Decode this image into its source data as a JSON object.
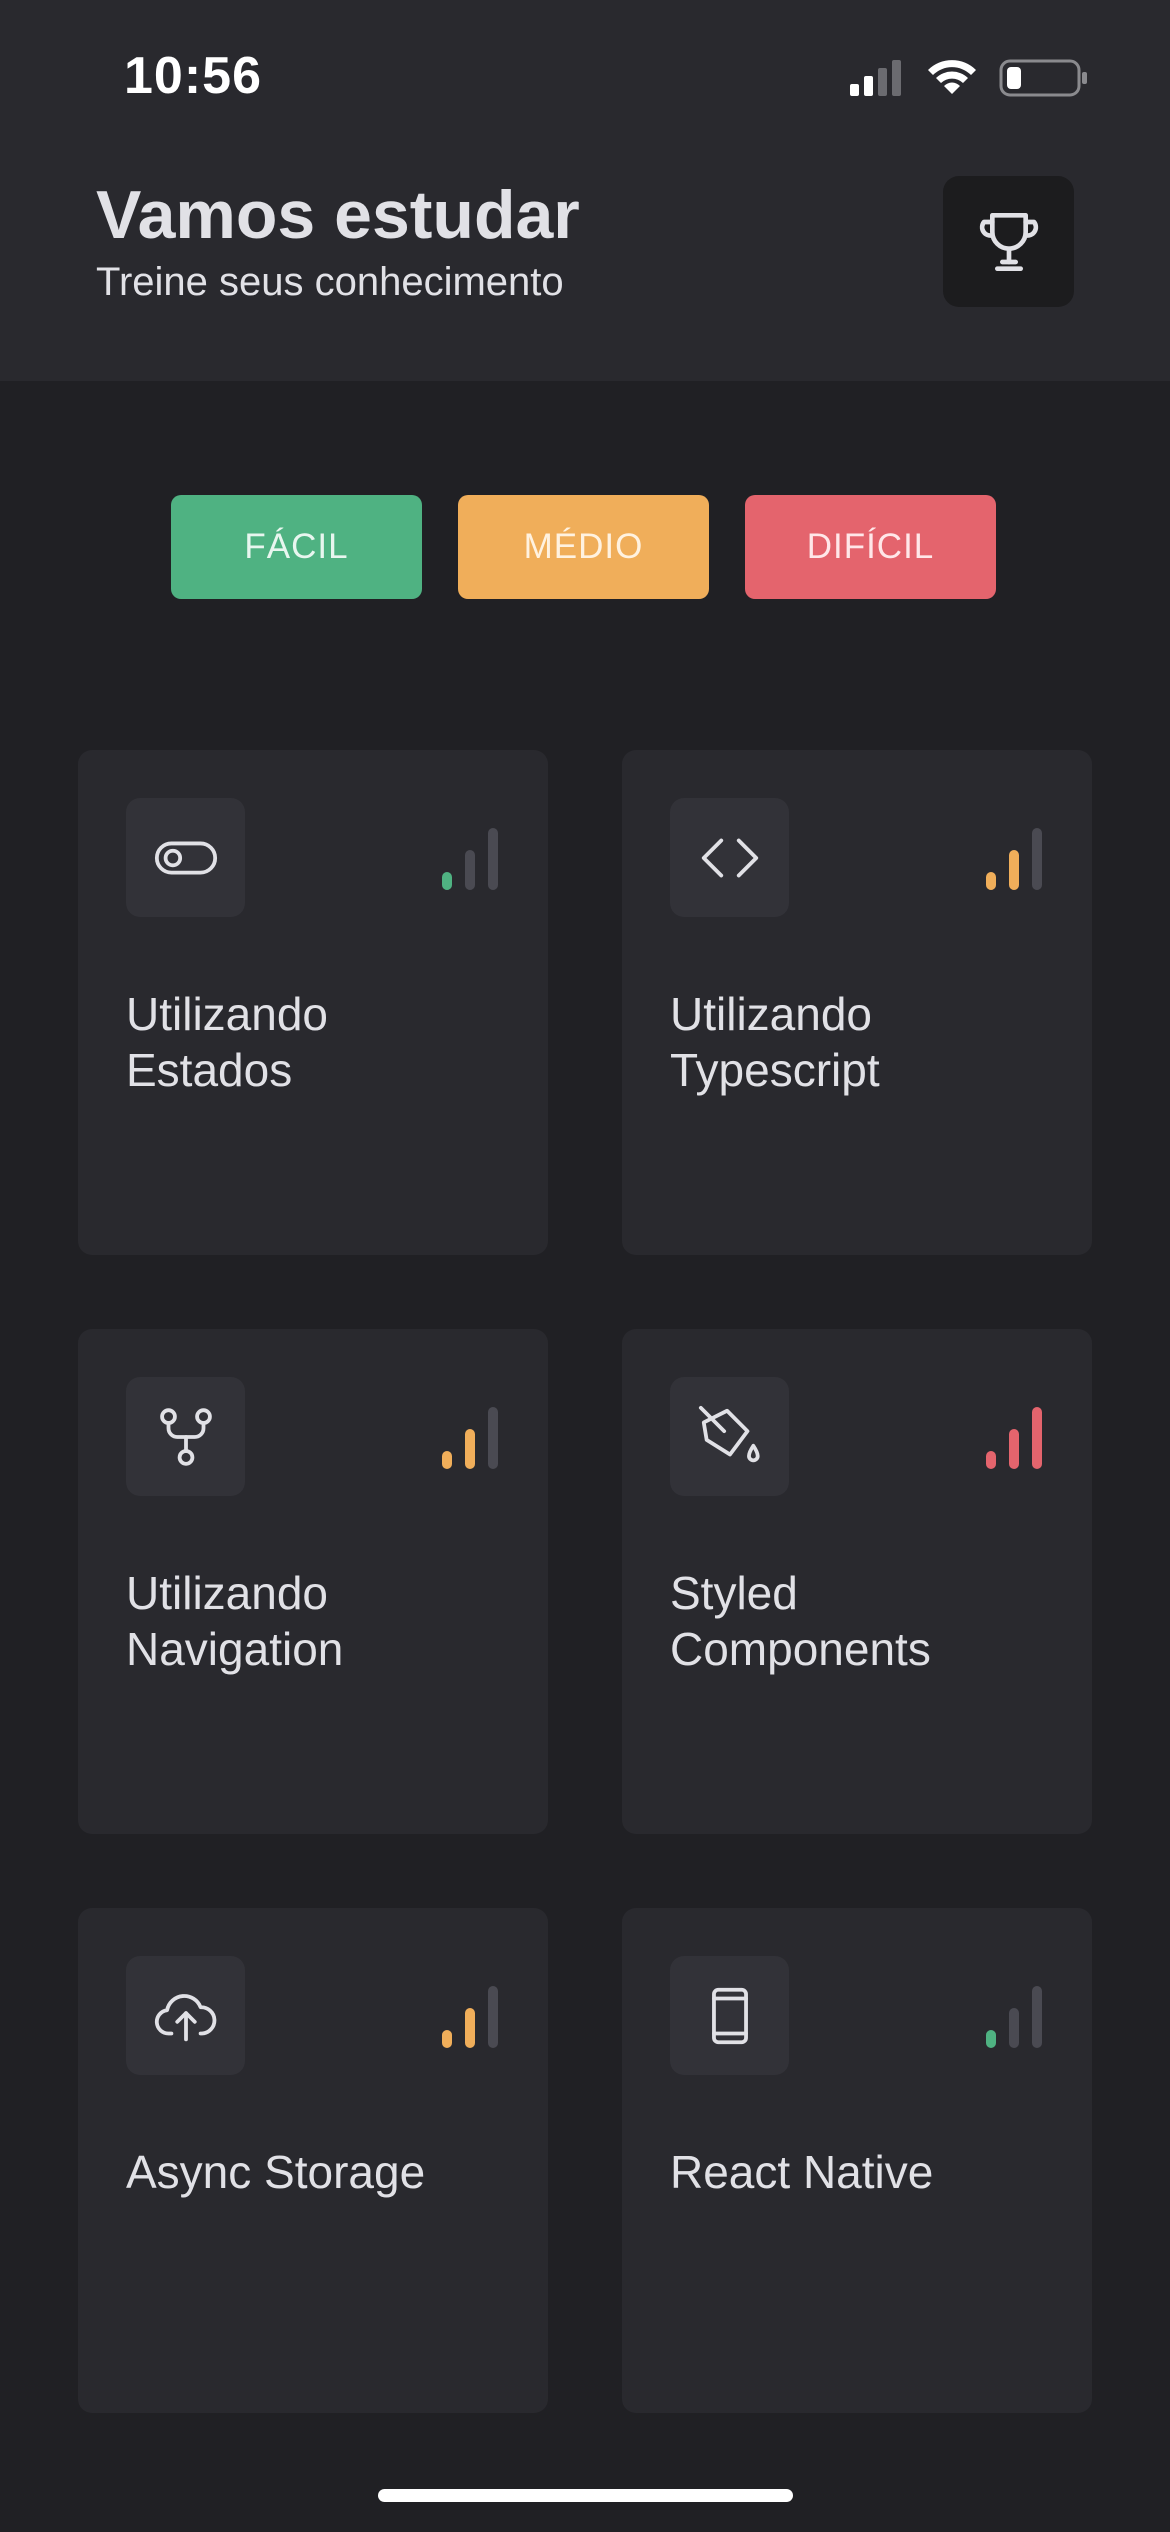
{
  "status_bar": {
    "time": "10:56"
  },
  "header": {
    "title": "Vamos estudar",
    "subtitle": "Treine seus conhecimento",
    "trophy_icon": "trophy-icon"
  },
  "filters": [
    {
      "label": "FÁCIL",
      "color": "#4fb282"
    },
    {
      "label": "MÉDIO",
      "color": "#f0ae5a"
    },
    {
      "label": "DIFÍCIL",
      "color": "#e4646d"
    }
  ],
  "level_colors": {
    "easy": "#4fb282",
    "medium": "#f0ae5a",
    "hard": "#e4646d",
    "inactive": "#4a4a52"
  },
  "cards": [
    {
      "title": "Utilizando Estados",
      "icon": "toggle-icon",
      "level": "easy"
    },
    {
      "title": "Utilizando Typescript",
      "icon": "code-icon",
      "level": "medium"
    },
    {
      "title": "Utilizando Navigation",
      "icon": "git-branch-icon",
      "level": "medium"
    },
    {
      "title": "Styled Components",
      "icon": "paint-bucket-icon",
      "level": "hard"
    },
    {
      "title": "Async Storage",
      "icon": "cloud-upload-icon",
      "level": "medium"
    },
    {
      "title": "React Native",
      "icon": "smartphone-icon",
      "level": "easy"
    }
  ]
}
